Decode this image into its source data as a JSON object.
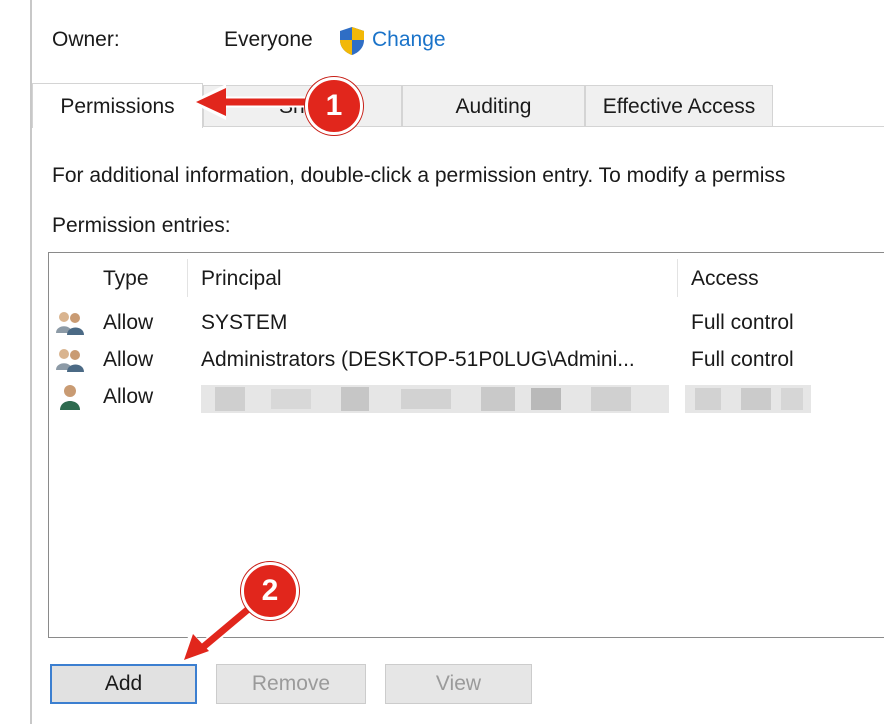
{
  "owner": {
    "label": "Owner:",
    "value": "Everyone",
    "change_link": "Change"
  },
  "tabs": [
    {
      "label": "Permissions",
      "active": true
    },
    {
      "label": "Sh",
      "active": false
    },
    {
      "label": "Auditing",
      "active": false
    },
    {
      "label": "Effective Access",
      "active": false
    }
  ],
  "info_text": "For additional information, double-click a permission entry. To modify a permiss",
  "entries_label": "Permission entries:",
  "table": {
    "headers": [
      "Type",
      "Principal",
      "Access"
    ],
    "rows": [
      {
        "icon": "user-group-icon",
        "type": "Allow",
        "principal": "SYSTEM",
        "access": "Full control"
      },
      {
        "icon": "user-group-icon",
        "type": "Allow",
        "principal": "Administrators (DESKTOP-51P0LUG\\Admini...",
        "access": "Full control"
      },
      {
        "icon": "user-icon",
        "type": "Allow",
        "principal": "",
        "access": ""
      }
    ]
  },
  "buttons": {
    "add": "Add",
    "remove": "Remove",
    "view": "View"
  },
  "annotations": {
    "step1": "1",
    "step2": "2",
    "color": "#e1261c"
  },
  "colors": {
    "link": "#1a73c9",
    "focus_border": "#3c7fd0"
  }
}
